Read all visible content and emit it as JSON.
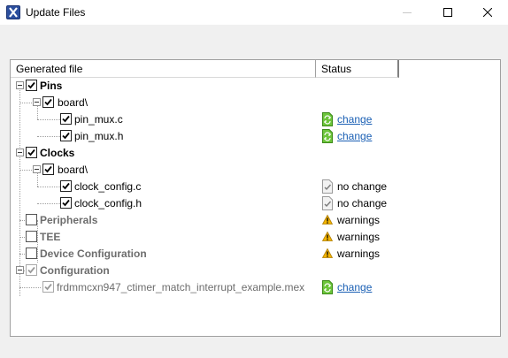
{
  "window": {
    "title": "Update Files",
    "icon": "nxp-x-icon",
    "controls": [
      "minimize",
      "maximize",
      "close"
    ]
  },
  "table": {
    "columns": [
      "Generated file",
      "Status"
    ],
    "rows": [
      {
        "label": "Pins",
        "checked": true,
        "expanded": true,
        "status": ""
      },
      {
        "label": "board\\",
        "checked": true,
        "expanded": true,
        "status": ""
      },
      {
        "label": "pin_mux.c",
        "checked": true,
        "status": "change",
        "status_icon": "file-changed-icon"
      },
      {
        "label": "pin_mux.h",
        "checked": true,
        "status": "change",
        "status_icon": "file-changed-icon"
      },
      {
        "label": "Clocks",
        "checked": true,
        "expanded": true,
        "status": ""
      },
      {
        "label": "board\\",
        "checked": true,
        "expanded": true,
        "status": ""
      },
      {
        "label": "clock_config.c",
        "checked": true,
        "status": "no change",
        "status_icon": "file-unchanged-icon"
      },
      {
        "label": "clock_config.h",
        "checked": true,
        "status": "no change",
        "status_icon": "file-unchanged-icon"
      },
      {
        "label": "Peripherals",
        "checked": false,
        "status": "warnings",
        "status_icon": "warning-icon"
      },
      {
        "label": "TEE",
        "checked": false,
        "status": "warnings",
        "status_icon": "warning-icon"
      },
      {
        "label": "Device Configuration",
        "checked": false,
        "status": "warnings",
        "status_icon": "warning-icon"
      },
      {
        "label": "Configuration",
        "checked": true,
        "disabled": true,
        "expanded": true,
        "status": ""
      },
      {
        "label": "frdmmcxn947_ctimer_match_interrupt_example.mex",
        "checked": true,
        "disabled": true,
        "status": "change",
        "status_icon": "file-changed-icon"
      }
    ]
  },
  "colors": {
    "link": "#1a5fb4",
    "disabled_text": "#6d6d6d",
    "change_icon": "#4caf1f",
    "warning_icon": "#f3b400"
  }
}
